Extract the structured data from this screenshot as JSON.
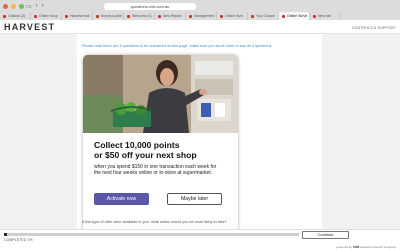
{
  "browser": {
    "url": "questions.cint.com.au",
    "tabs": [
      {
        "label": "Outlook (2)",
        "active": false
      },
      {
        "label": "Online shop",
        "active": false
      },
      {
        "label": "Harvest mail",
        "active": false
      },
      {
        "label": "Surveys point",
        "active": false
      },
      {
        "label": "Welcome (1)",
        "active": false
      },
      {
        "label": "New Report",
        "active": false
      },
      {
        "label": "Management",
        "active": false
      },
      {
        "label": "Online Surv",
        "active": false
      },
      {
        "label": "Your Choice",
        "active": false
      },
      {
        "label": "Online Surve",
        "active": true
      },
      {
        "label": "New tab",
        "active": false
      }
    ]
  },
  "header": {
    "logo": "HARVEST",
    "right_link": "CONTROLS & SUPPORT"
  },
  "notice": "Please note there are 4 questions to be answered on this page. Make sure you scroll down to see all 4 questions.",
  "card": {
    "headline_line1": "Collect 10,000 points",
    "headline_line2": "or $50 off your next shop",
    "body_line1": "when you spend $150 in one transaction each week for",
    "body_line2": "the next four weeks online or in-store at supermarket.",
    "activate_label": "Activate now",
    "later_label": "Maybe later"
  },
  "question_peek": "If this type of offer were available to you, what action would you be most likely to take?",
  "footer": {
    "progress_percent": 1,
    "progress_label": "COMPLETED 1%",
    "continue_label": "Continue",
    "powered_prefix": "powered by",
    "powered_brand": "cint",
    "powered_suffix": "Harvest research company"
  },
  "colors": {
    "accent_button": "#5b57a8",
    "notice_text": "#3b8fd4"
  }
}
